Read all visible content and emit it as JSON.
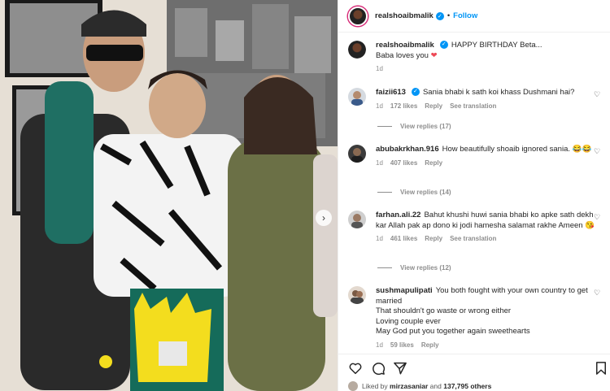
{
  "post": {
    "username": "realshoaibmalik",
    "follow_label": "Follow",
    "dot": "•",
    "caption_line1": "HAPPY BIRTHDAY Beta...",
    "caption_line2": "Baba loves you",
    "caption_emoji": "❤",
    "caption_time": "1d"
  },
  "comments": [
    {
      "username": "faizii613",
      "verified": true,
      "text": "Sania bhabi k sath koi khass Dushmani hai?",
      "time": "1d",
      "likes": "172 likes",
      "reply": "Reply",
      "translate": "See translation",
      "view_replies": "View replies (17)"
    },
    {
      "username": "abubakrkhan.916",
      "text": "How beautifully shoaib ignored sania. 😂😂",
      "time": "1d",
      "likes": "407 likes",
      "reply": "Reply",
      "view_replies": "View replies (14)"
    },
    {
      "username": "farhan.ali.22",
      "text": "Bahut khushi huwi sania bhabi ko apke sath dekh kar Allah pak ap dono ki jodi hamesha salamat rakhe Ameen 😘",
      "time": "1d",
      "likes": "461 likes",
      "reply": "Reply",
      "translate": "See translation",
      "view_replies": "View replies (12)"
    },
    {
      "username": "sushmapulipati",
      "text_lines": [
        "You both fought with your own country to get married",
        "That shouldn't go waste or wrong either",
        "Loving couple ever",
        "May God put you together again sweethearts"
      ],
      "time": "1d",
      "likes": "59 likes",
      "reply": "Reply"
    }
  ],
  "footer": {
    "liked_by_prefix": "Liked by",
    "liked_by_user": "mirzasaniar",
    "and": "and",
    "others": "137,795 others"
  },
  "icons": [
    "verified-badge-icon",
    "heart-icon",
    "comment-icon",
    "share-icon",
    "bookmark-icon",
    "chevron-right-icon"
  ],
  "colors": {
    "accent": "#0095f6",
    "text": "#262626",
    "muted": "#8e8e8e",
    "heart_red": "#ed4956"
  }
}
